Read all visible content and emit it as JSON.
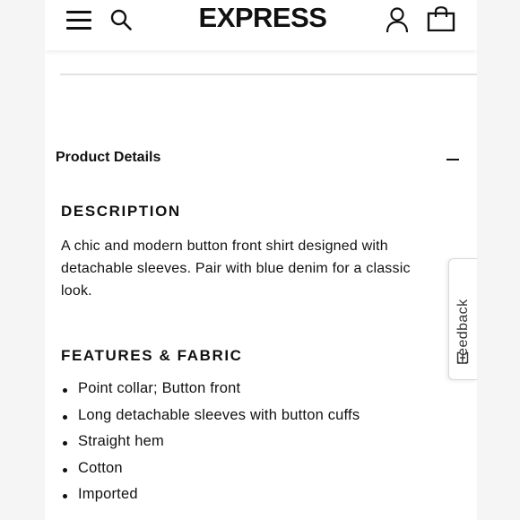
{
  "header": {
    "logo_text": "EXPRESS",
    "icons": [
      "hamburger-menu-icon",
      "search-icon",
      "account-icon",
      "shopping-bag-icon"
    ]
  },
  "product_details": {
    "title": "Product Details",
    "toggle_icon": "minus-icon",
    "description": {
      "heading": "DESCRIPTION",
      "text": "A chic and modern button front shirt designed with\ndetachable sleeves. Pair with blue denim for a classic\nlook."
    },
    "features": {
      "heading": "FEATURES & FABRIC",
      "items": [
        "Point collar; Button front",
        "Long detachable sleeves with button cuffs",
        "Straight hem",
        "Cotton",
        "Imported"
      ]
    }
  },
  "feedback": {
    "label": "Feedback",
    "icon": "plus-box-icon"
  },
  "colors": {
    "text": "#111111",
    "divider": "#e2e2e2",
    "side_background": "#f5f5f5"
  }
}
